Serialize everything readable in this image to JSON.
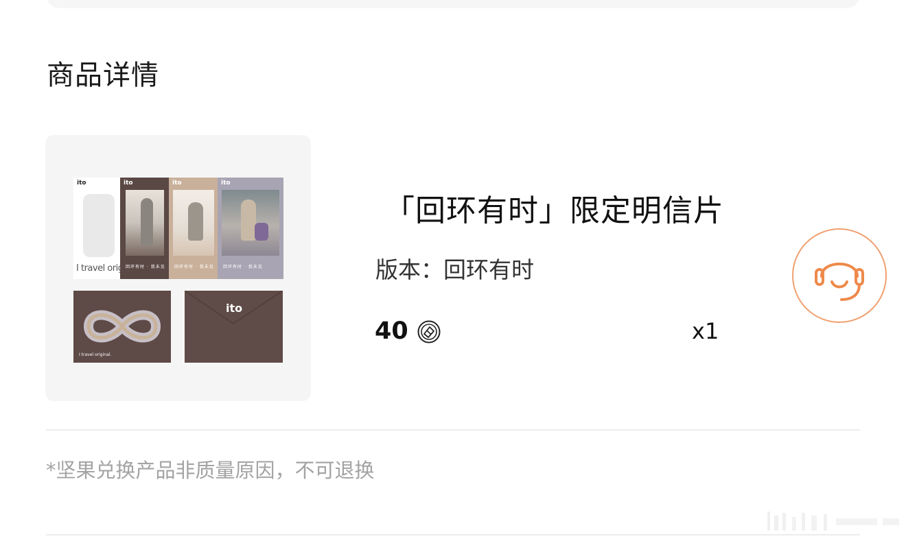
{
  "section": {
    "title": "商品详情"
  },
  "thumbnail": {
    "brand": "ito",
    "tagline_big": "I travel origi",
    "tagline_small": "I travel original.",
    "postcard_caption": "回环有时 · 我未见"
  },
  "product": {
    "name": "「回环有时」限定明信片",
    "version": "版本：回环有时",
    "price": "40",
    "currency_icon": "nut-coin-icon",
    "quantity": "x1"
  },
  "service": {
    "icon": "headset-icon",
    "color": "#ee8a4a"
  },
  "notice": {
    "text": "*坚果兑换产品非质量原因，不可退换"
  }
}
